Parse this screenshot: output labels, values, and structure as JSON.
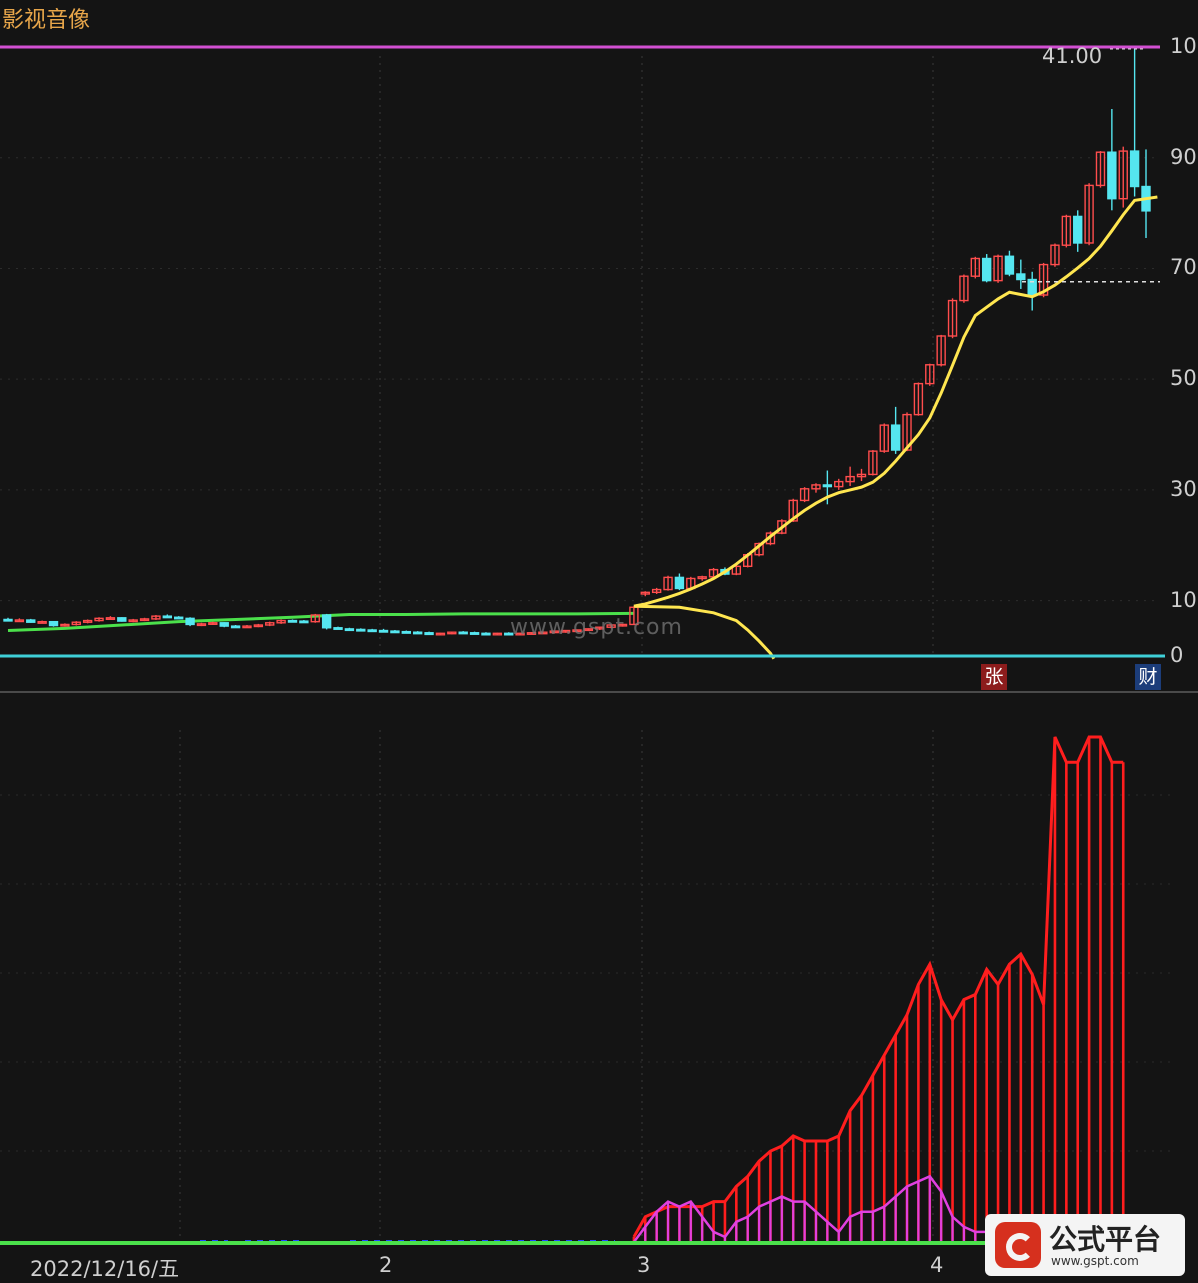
{
  "stock_name": "影视音像",
  "watermark": "www.gspt.com",
  "price_axis": [
    {
      "label": "10",
      "v": 110
    },
    {
      "label": "90",
      "v": 90
    },
    {
      "label": "70",
      "v": 70
    },
    {
      "label": "50",
      "v": 50
    },
    {
      "label": "30",
      "v": 30
    },
    {
      "label": "10",
      "v": 10
    },
    {
      "label": "0",
      "v": 0
    }
  ],
  "max_annotation": "41.00",
  "badges": [
    {
      "text": "张",
      "color": "#8c1c1c"
    },
    {
      "text": "财",
      "color": "#1c3d7a"
    }
  ],
  "date_labels": [
    "2022/12/16/五",
    "2",
    "3",
    "4"
  ],
  "logo_text": "公式平台",
  "logo_url": "www.gspt.com",
  "colors": {
    "up": "#ff4d4d",
    "down": "#55e6f0",
    "ma": "#ffe650",
    "band": "#4be04b",
    "top_line": "#d24fd2",
    "zero_line": "#3fd0d8",
    "osc_red": "#ff1e1e",
    "osc_magenta": "#e040e0",
    "blue_dots": "#2244ff"
  },
  "chart_data": [
    {
      "type": "candlestick",
      "title": "影视音像",
      "y_ticks": [
        0,
        10,
        30,
        50,
        70,
        90,
        110
      ],
      "ylim": [
        0,
        110
      ],
      "annotations": [
        "41.00"
      ],
      "candles": [
        [
          6.6,
          6.9,
          6.3,
          6.4
        ],
        [
          6.4,
          6.8,
          6.2,
          6.5
        ],
        [
          6.5,
          6.7,
          6.0,
          6.1
        ],
        [
          6.1,
          6.4,
          5.9,
          6.2
        ],
        [
          6.2,
          6.3,
          5.3,
          5.5
        ],
        [
          5.5,
          5.9,
          5.3,
          5.7
        ],
        [
          5.7,
          6.3,
          5.5,
          6.1
        ],
        [
          6.1,
          6.6,
          5.9,
          6.4
        ],
        [
          6.4,
          7.0,
          6.2,
          6.8
        ],
        [
          6.8,
          7.2,
          6.6,
          6.9
        ],
        [
          6.9,
          7.0,
          6.2,
          6.3
        ],
        [
          6.3,
          6.7,
          6.1,
          6.5
        ],
        [
          6.5,
          6.9,
          6.3,
          6.7
        ],
        [
          6.7,
          7.4,
          6.5,
          7.2
        ],
        [
          7.2,
          7.5,
          6.9,
          7.0
        ],
        [
          7.0,
          7.2,
          6.7,
          6.8
        ],
        [
          6.8,
          7.0,
          5.4,
          5.7
        ],
        [
          5.7,
          6.0,
          5.4,
          5.8
        ],
        [
          5.8,
          6.2,
          5.6,
          6.0
        ],
        [
          6.0,
          6.1,
          5.2,
          5.4
        ],
        [
          5.4,
          5.6,
          5.1,
          5.3
        ],
        [
          5.3,
          5.6,
          5.1,
          5.4
        ],
        [
          5.4,
          5.8,
          5.2,
          5.6
        ],
        [
          5.6,
          6.2,
          5.4,
          6.0
        ],
        [
          6.0,
          6.6,
          5.8,
          6.4
        ],
        [
          6.4,
          6.6,
          6.1,
          6.3
        ],
        [
          6.3,
          6.5,
          6.1,
          6.2
        ],
        [
          6.2,
          7.6,
          6.0,
          7.4
        ],
        [
          7.4,
          7.6,
          4.8,
          5.1
        ],
        [
          5.1,
          5.3,
          4.8,
          4.9
        ],
        [
          4.9,
          5.1,
          4.6,
          4.8
        ],
        [
          4.8,
          5.0,
          4.6,
          4.7
        ],
        [
          4.7,
          4.9,
          4.5,
          4.6
        ],
        [
          4.6,
          4.9,
          4.4,
          4.5
        ],
        [
          4.5,
          4.7,
          4.3,
          4.4
        ],
        [
          4.4,
          4.6,
          4.2,
          4.3
        ],
        [
          4.3,
          4.5,
          4.1,
          4.2
        ],
        [
          4.2,
          4.4,
          3.9,
          3.9
        ],
        [
          3.9,
          4.2,
          3.8,
          4.1
        ],
        [
          4.1,
          4.4,
          3.9,
          4.3
        ],
        [
          4.3,
          4.5,
          4.1,
          4.2
        ],
        [
          4.2,
          4.4,
          4.0,
          4.1
        ],
        [
          4.1,
          4.3,
          3.9,
          4.0
        ],
        [
          4.0,
          4.2,
          3.9,
          4.1
        ],
        [
          4.1,
          4.3,
          3.9,
          4.0
        ],
        [
          4.0,
          4.2,
          3.8,
          4.1
        ],
        [
          4.1,
          4.3,
          3.9,
          4.2
        ],
        [
          4.2,
          4.4,
          4.0,
          4.3
        ],
        [
          4.3,
          4.6,
          4.1,
          4.5
        ],
        [
          4.5,
          4.7,
          4.2,
          4.6
        ],
        [
          4.6,
          4.8,
          4.4,
          4.7
        ],
        [
          4.7,
          5.0,
          4.5,
          4.9
        ],
        [
          4.9,
          5.3,
          4.7,
          5.2
        ],
        [
          5.2,
          5.7,
          5.0,
          5.6
        ],
        [
          5.6,
          5.8,
          5.3,
          5.7
        ],
        [
          5.7,
          9.0,
          5.7,
          8.8
        ],
        [
          11.2,
          11.7,
          10.8,
          11.5
        ],
        [
          11.5,
          12.3,
          11.2,
          12.0
        ],
        [
          12.0,
          14.5,
          11.8,
          14.2
        ],
        [
          14.2,
          14.9,
          11.9,
          12.2
        ],
        [
          12.2,
          14.3,
          12.0,
          14.0
        ],
        [
          14.0,
          14.5,
          13.6,
          14.3
        ],
        [
          14.3,
          15.9,
          14.0,
          15.6
        ],
        [
          15.6,
          16.0,
          14.6,
          14.8
        ],
        [
          14.8,
          16.4,
          14.6,
          16.2
        ],
        [
          16.2,
          18.6,
          16.0,
          18.3
        ],
        [
          18.3,
          20.5,
          18.0,
          20.3
        ],
        [
          20.3,
          22.5,
          20.0,
          22.2
        ],
        [
          22.2,
          24.7,
          22.0,
          24.4
        ],
        [
          24.4,
          28.4,
          24.2,
          28.1
        ],
        [
          28.1,
          30.5,
          27.8,
          30.2
        ],
        [
          30.2,
          31.2,
          29.5,
          30.9
        ],
        [
          30.9,
          33.5,
          27.4,
          30.6
        ],
        [
          30.6,
          32.0,
          30.0,
          31.5
        ],
        [
          31.5,
          34.2,
          30.7,
          32.4
        ],
        [
          32.4,
          33.8,
          31.6,
          32.8
        ],
        [
          32.8,
          37.2,
          32.6,
          37.0
        ],
        [
          37.0,
          42.0,
          36.7,
          41.7
        ],
        [
          41.7,
          45.0,
          36.5,
          37.2
        ],
        [
          37.2,
          44.0,
          37.0,
          43.6
        ],
        [
          43.6,
          49.4,
          43.4,
          49.2
        ],
        [
          49.2,
          52.8,
          48.8,
          52.6
        ],
        [
          52.6,
          58.0,
          52.3,
          57.8
        ],
        [
          57.8,
          64.6,
          57.4,
          64.2
        ],
        [
          64.2,
          68.9,
          63.8,
          68.6
        ],
        [
          68.6,
          72.1,
          68.2,
          71.8
        ],
        [
          71.8,
          72.6,
          67.5,
          67.8
        ],
        [
          67.8,
          72.5,
          67.4,
          72.2
        ],
        [
          72.2,
          73.2,
          68.6,
          69.0
        ],
        [
          69.0,
          71.6,
          66.3,
          68.0
        ],
        [
          68.0,
          69.4,
          62.4,
          65.2
        ],
        [
          65.2,
          71.0,
          64.8,
          70.7
        ],
        [
          70.7,
          74.5,
          70.3,
          74.2
        ],
        [
          74.2,
          79.7,
          73.8,
          79.4
        ],
        [
          79.4,
          80.5,
          73.0,
          74.6
        ],
        [
          74.6,
          85.4,
          74.2,
          85.0
        ],
        [
          85.0,
          91.2,
          84.6,
          91.0
        ],
        [
          91.0,
          98.8,
          80.5,
          82.6
        ],
        [
          82.6,
          92.0,
          81.0,
          91.2
        ],
        [
          91.2,
          110.0,
          83.0,
          84.8
        ],
        [
          84.8,
          91.5,
          75.5,
          80.4
        ]
      ],
      "ma_line": [
        [
          55,
          9.0
        ],
        [
          56,
          9.4
        ],
        [
          57,
          10.0
        ],
        [
          58,
          10.6
        ],
        [
          59,
          11.3
        ],
        [
          60,
          12.1
        ],
        [
          61,
          13.0
        ],
        [
          62,
          14.0
        ],
        [
          63,
          15.2
        ],
        [
          64,
          16.6
        ],
        [
          65,
          18.2
        ],
        [
          66,
          19.9
        ],
        [
          67,
          21.6
        ],
        [
          68,
          23.2
        ],
        [
          69,
          24.8
        ],
        [
          70,
          26.3
        ],
        [
          71,
          27.6
        ],
        [
          72,
          28.7
        ],
        [
          73,
          29.5
        ],
        [
          74,
          30.0
        ],
        [
          75,
          30.5
        ],
        [
          76,
          31.4
        ],
        [
          77,
          33.0
        ],
        [
          78,
          35.2
        ],
        [
          79,
          37.6
        ],
        [
          80,
          40.0
        ],
        [
          81,
          43.0
        ],
        [
          82,
          47.5
        ],
        [
          83,
          52.5
        ],
        [
          84,
          57.6
        ],
        [
          85,
          61.5
        ],
        [
          86,
          63.0
        ],
        [
          87,
          64.5
        ],
        [
          88,
          65.7
        ],
        [
          89,
          65.3
        ],
        [
          90,
          64.9
        ],
        [
          91,
          65.8
        ],
        [
          92,
          67.0
        ],
        [
          93,
          68.5
        ],
        [
          94,
          70.1
        ],
        [
          95,
          71.8
        ],
        [
          96,
          74.0
        ],
        [
          97,
          76.8
        ],
        [
          98,
          79.7
        ],
        [
          99,
          82.3
        ],
        [
          100,
          82.6
        ],
        [
          101,
          82.9
        ]
      ],
      "ma_tail": [
        [
          55,
          9.0
        ],
        [
          59,
          8.8
        ],
        [
          62,
          7.8
        ],
        [
          64,
          6.4
        ],
        [
          65,
          4.7
        ],
        [
          66,
          2.7
        ],
        [
          67,
          0.5
        ],
        [
          67.3,
          -0.5
        ]
      ],
      "band_line": [
        [
          0,
          4.6
        ],
        [
          5,
          5.0
        ],
        [
          10,
          5.6
        ],
        [
          15,
          6.2
        ],
        [
          20,
          6.6
        ],
        [
          25,
          7.0
        ],
        [
          30,
          7.5
        ],
        [
          35,
          7.5
        ],
        [
          40,
          7.6
        ],
        [
          45,
          7.6
        ],
        [
          50,
          7.6
        ],
        [
          55,
          7.7
        ]
      ],
      "dashed_reference": 67.6
    },
    {
      "type": "bar",
      "title": "",
      "series": [
        {
          "values": [
            0,
            0,
            0,
            0,
            0,
            0,
            0,
            0,
            0,
            0,
            0,
            0,
            0,
            0,
            0,
            0,
            0,
            0,
            0,
            0,
            0,
            0,
            0,
            0,
            0,
            0,
            0,
            0,
            0,
            0,
            0,
            0,
            0,
            0,
            0,
            0,
            0,
            0,
            0,
            0,
            0,
            0,
            0,
            0,
            0,
            0,
            0,
            0,
            0,
            0,
            0,
            0,
            0,
            0,
            0,
            1,
            5,
            6,
            7,
            7,
            7,
            7,
            8,
            8,
            11,
            13,
            16,
            18,
            19,
            21,
            20,
            20,
            20,
            21,
            26,
            29,
            33,
            37,
            41,
            45,
            51,
            55,
            48,
            44,
            48,
            49,
            54,
            51,
            55,
            57,
            53,
            47,
            100,
            95,
            95,
            100,
            100,
            95,
            95
          ]
        },
        {
          "values": [
            0,
            0,
            0,
            0,
            0,
            0,
            0,
            0,
            0,
            0,
            0,
            0,
            0,
            0,
            0,
            0,
            0,
            0,
            0,
            0,
            0,
            0,
            0,
            0,
            0,
            0,
            0,
            0,
            0,
            0,
            0,
            0,
            0,
            0,
            0,
            0,
            0,
            0,
            0,
            0,
            0,
            0,
            0,
            0,
            0,
            0,
            0,
            0,
            0,
            0,
            0,
            0,
            0,
            0,
            0,
            0,
            3,
            6,
            8,
            7,
            8,
            5,
            2,
            1,
            4,
            5,
            7,
            8,
            9,
            8,
            8,
            6,
            4,
            2,
            5,
            6,
            6,
            7,
            9,
            11,
            12,
            13,
            10,
            5,
            3,
            2,
            2,
            1,
            1,
            2,
            7,
            8,
            0,
            0,
            0,
            0,
            0,
            0,
            0
          ]
        }
      ]
    }
  ]
}
